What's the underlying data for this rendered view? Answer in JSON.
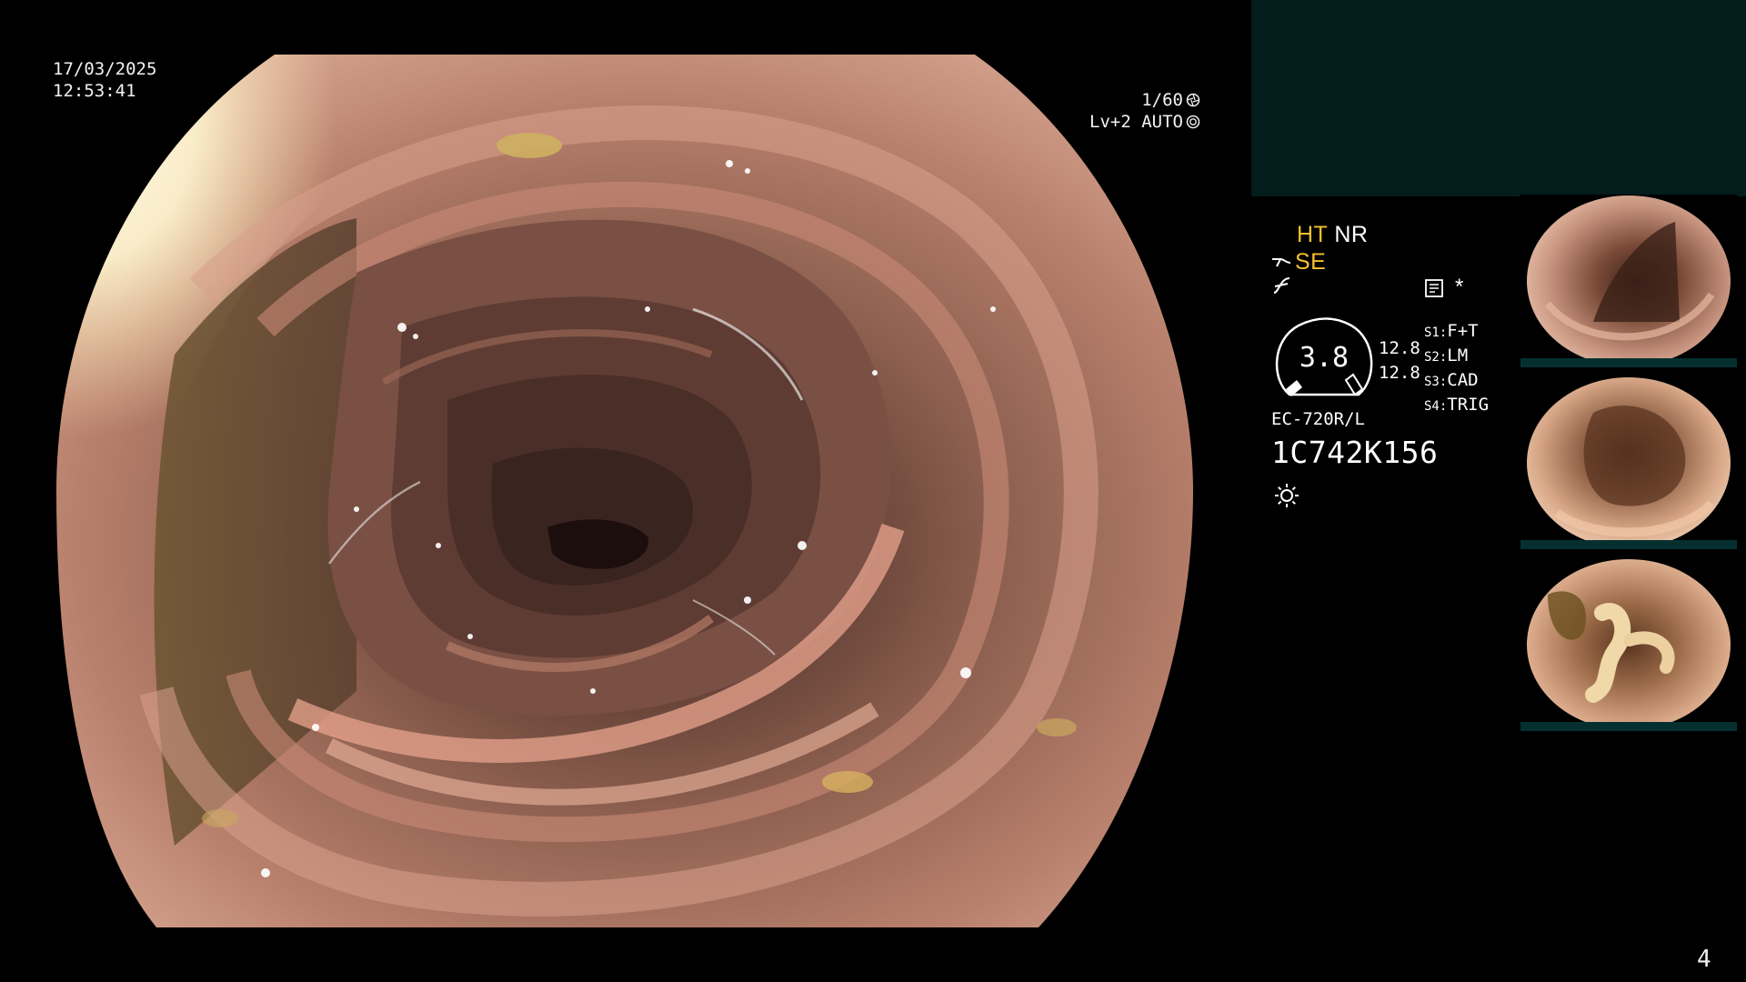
{
  "overlay": {
    "date": "17/03/2025",
    "time": "12:53:41",
    "shutter": "1/60",
    "level": "Lv+2 AUTO"
  },
  "info": {
    "ht": "HT",
    "nr": "NR",
    "se": "SE",
    "asterisk": "*",
    "gauge_value": "3.8",
    "side_values": [
      "12.8",
      "12.8"
    ],
    "scope_labels": [
      {
        "key": "S1:",
        "value": "F+T"
      },
      {
        "key": "S2:",
        "value": "LM"
      },
      {
        "key": "S3:",
        "value": "CAD"
      },
      {
        "key": "S4:",
        "value": "TRIG"
      }
    ],
    "scope_model": "EC-720R/L",
    "serial": "1C742K156"
  },
  "page_number": "4",
  "colors": {
    "panel_teal": "#031c1c",
    "highlight_yellow": "#f4c22b",
    "mucosa": "#b87a68",
    "lumen": "#3a2420"
  },
  "icons": [
    "shutter-icon",
    "auto-iris-icon",
    "curve-icon",
    "doc-icon",
    "gauge-icon",
    "light-icon"
  ]
}
